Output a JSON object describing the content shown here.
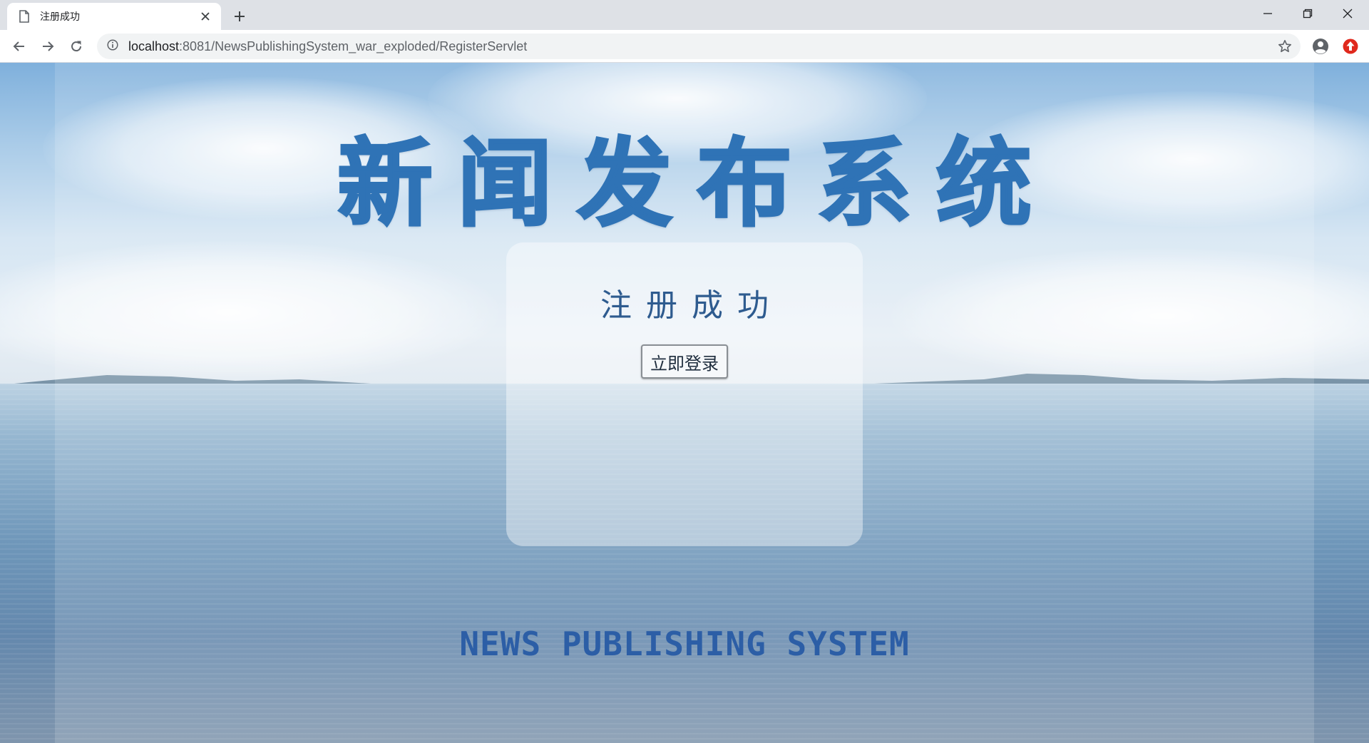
{
  "browser": {
    "tab": {
      "title": "注册成功"
    },
    "address_bar": {
      "url_host": "localhost",
      "url_rest": ":8081/NewsPublishingSystem_war_exploded/RegisterServlet"
    },
    "icons": {
      "tab_page": "document-icon",
      "tab_close": "close-icon",
      "new_tab": "plus-icon",
      "back": "arrow-left-icon",
      "forward": "arrow-right-icon",
      "reload": "reload-icon",
      "site_info": "info-icon",
      "bookmark": "star-icon",
      "profile": "account-icon",
      "extension": "extension-icon"
    },
    "window_controls": {
      "minimize": "minimize-icon",
      "restore": "restore-icon",
      "close": "window-close-icon"
    }
  },
  "page": {
    "site_title": "新闻发布系统",
    "card": {
      "message": "注册成功",
      "login_button": "立即登录"
    },
    "footer_text": "NEWS PUBLISHING SYSTEM"
  },
  "colors": {
    "title_blue": "#2f73b6",
    "message_blue": "#2e5b8f",
    "footer_blue": "#2c5ea6",
    "chrome_gray": "#dee1e6",
    "extension_red": "#e0291d"
  }
}
